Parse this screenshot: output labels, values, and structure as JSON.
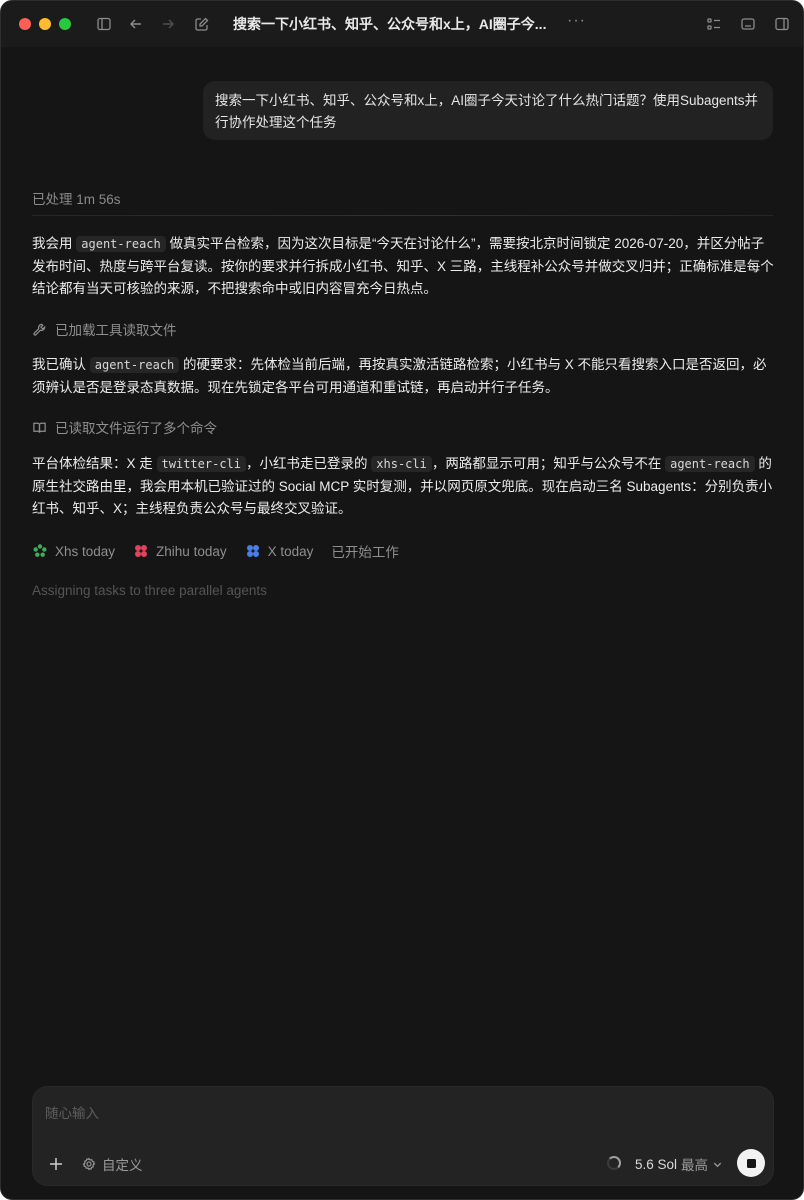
{
  "window": {
    "title": "搜索一下小红书、知乎、公众号和x上，AI圈子今...",
    "more_label": "···"
  },
  "conversation": {
    "user_message": "搜索一下小红书、知乎、公众号和x上，AI圈子今天讨论了什么热门话题？使用Subagents并行协作处理这个任务",
    "processed_label": "已处理 1m 56s",
    "para1": {
      "t1": "我会用 ",
      "code1": "agent-reach",
      "t2": " 做真实平台检索，因为这次目标是“今天在讨论什么”，需要按北京时间锁定 2026-07-20，并区分帖子发布时间、热度与跨平台复读。按你的要求并行拆成小红书、知乎、X 三路，主线程补公众号并做交叉归并；正确标准是每个结论都有当天可核验的来源，不把搜索命中或旧内容冒充今日热点。"
    },
    "tool1_label": "已加载工具读取文件",
    "para2": {
      "t1": "我已确认 ",
      "code1": "agent-reach",
      "t2": " 的硬要求：先体检当前后端，再按真实激活链路检索；小红书与 X 不能只看搜索入口是否返回，必须辨认是否是登录态真数据。现在先锁定各平台可用通道和重试链，再启动并行子任务。"
    },
    "tool2_label": "已读取文件运行了多个命令",
    "para3": {
      "t1": "平台体检结果：X 走 ",
      "code1": "twitter-cli",
      "t2": "，小红书走已登录的 ",
      "code2": "xhs-cli",
      "t3": "，两路都显示可用；知乎与公众号不在 ",
      "code3": "agent-reach",
      "t4": " 的原生社交路由里，我会用本机已验证过的 Social MCP 实时复测，并以网页原文兜底。现在启动三名 Subagents：分别负责小红书、知乎、X；主线程负责公众号与最终交叉验证。"
    },
    "agents": [
      {
        "label": "Xhs today",
        "color": "#3fae5a"
      },
      {
        "label": "Zhihu today",
        "color": "#e0445a"
      },
      {
        "label": "X today",
        "color": "#4a7fe8"
      }
    ],
    "agents_status": "已开始工作",
    "assigning_label": "Assigning tasks to three parallel agents"
  },
  "composer": {
    "placeholder": "随心输入",
    "custom_label": "自定义",
    "model_name": "5.6 Sol",
    "model_level": "最高"
  }
}
